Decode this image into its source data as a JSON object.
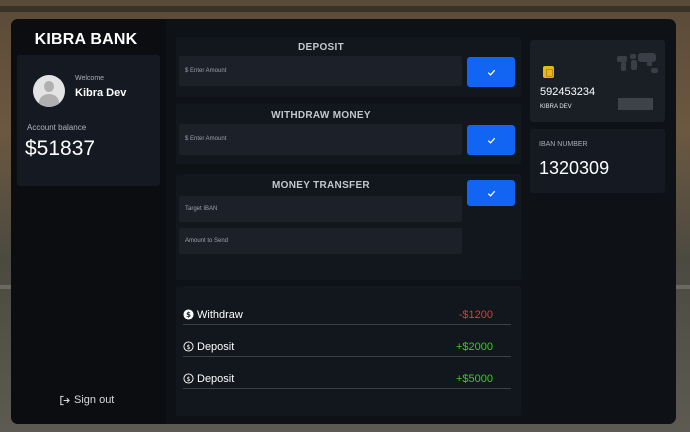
{
  "sidebar": {
    "brand": "KIBRA BANK",
    "welcome_label": "Welcome",
    "user_name": "Kibra Dev",
    "balance_label": "Account balance",
    "balance_value": "$51837",
    "sign_out": "Sign out"
  },
  "deposit": {
    "title": "DEPOSIT",
    "amount_placeholder": "$ Enter Amount"
  },
  "withdraw": {
    "title": "WITHDRAW MONEY",
    "amount_placeholder": "$ Enter Amount"
  },
  "transfer": {
    "title": "MONEY TRANSFER",
    "iban_placeholder": "Target IBAN",
    "amount_placeholder": "Amount to Send"
  },
  "transactions": [
    {
      "type": "Withdraw",
      "amount": "-$1200",
      "color": "#e53935",
      "icon": "withdraw-icon"
    },
    {
      "type": "Deposit",
      "amount": "+$2000",
      "color": "#33d11e",
      "icon": "deposit-icon"
    },
    {
      "type": "Deposit",
      "amount": "+$5000",
      "color": "#33d11e",
      "icon": "deposit-icon"
    }
  ],
  "card": {
    "number": "592453234",
    "holder": "KIBRA DEV"
  },
  "iban": {
    "label": "IBAN NUMBER",
    "value": "1320309"
  },
  "colors": {
    "accent": "#1264f3",
    "negative": "#e53935",
    "positive": "#33d11e"
  }
}
